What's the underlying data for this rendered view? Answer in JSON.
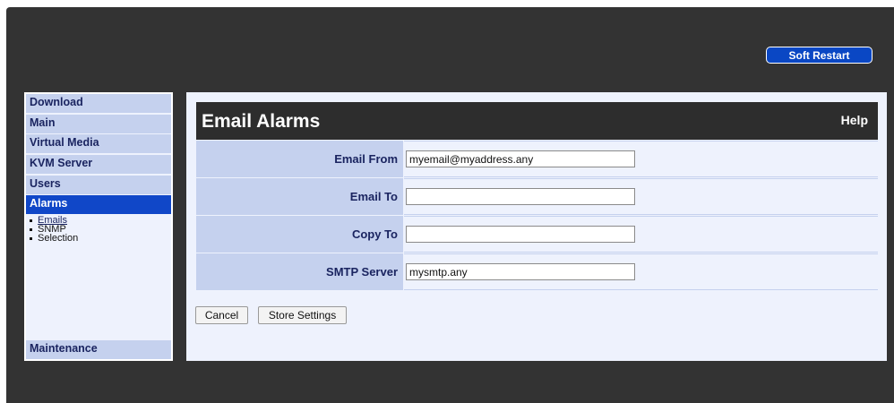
{
  "header": {
    "soft_restart_label": "Soft Restart"
  },
  "sidebar": {
    "items": [
      {
        "label": "Download"
      },
      {
        "label": "Main"
      },
      {
        "label": "Virtual Media"
      },
      {
        "label": "KVM Server"
      },
      {
        "label": "Users"
      },
      {
        "label": "Alarms",
        "active": true
      },
      {
        "label": "Maintenance"
      }
    ],
    "sub_items": [
      {
        "label": "Emails",
        "current": true
      },
      {
        "label": "SNMP"
      },
      {
        "label": "Selection"
      }
    ]
  },
  "main": {
    "title": "Email Alarms",
    "help_label": "Help",
    "fields": [
      {
        "label": "Email From",
        "value": "myemail@myaddress.any"
      },
      {
        "label": "Email To",
        "value": ""
      },
      {
        "label": "Copy To",
        "value": ""
      },
      {
        "label": "SMTP Server",
        "value": "mysmtp.any"
      }
    ],
    "cancel_label": "Cancel",
    "store_label": "Store Settings"
  },
  "colors": {
    "frame_bg": "#333333",
    "accent": "#1047c8",
    "nav_bg": "#c5d1ee",
    "panel_bg": "#eef2fd"
  }
}
